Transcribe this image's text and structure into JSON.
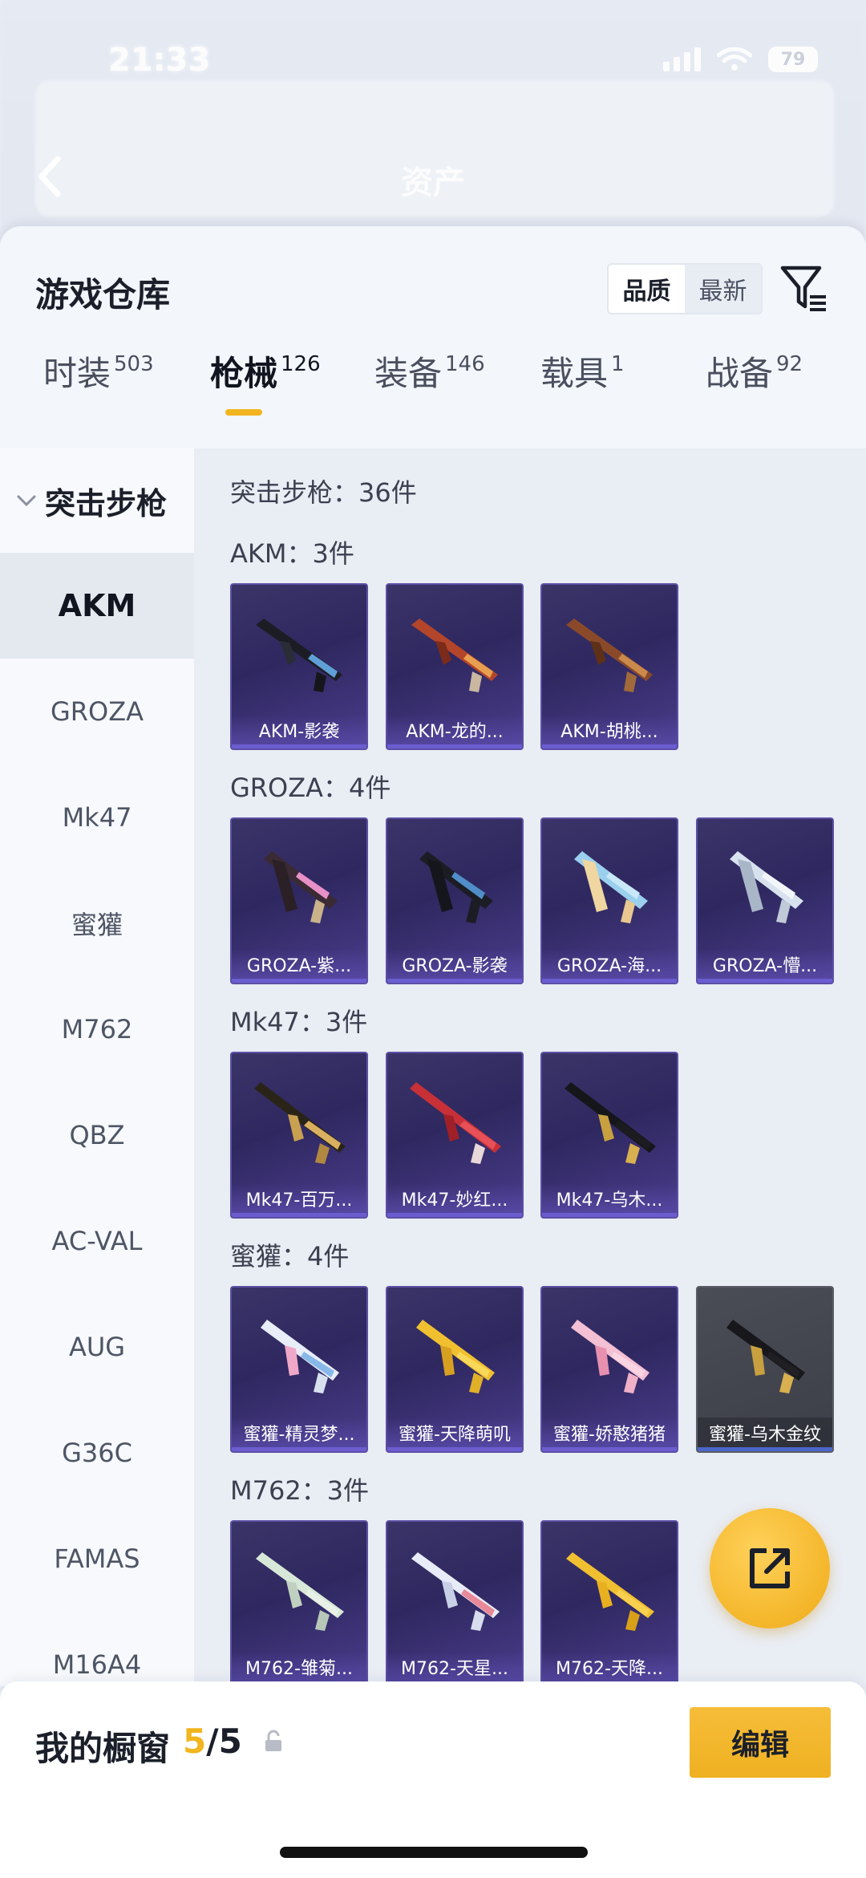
{
  "status_bar": {
    "time": "21:33",
    "battery": "79"
  },
  "header": {
    "title": "资产"
  },
  "sheet": {
    "title": "游戏仓库"
  },
  "sort": {
    "quality": "品质",
    "newest": "最新"
  },
  "tabs": [
    {
      "label": "时装",
      "count": "503"
    },
    {
      "label": "枪械",
      "count": "126"
    },
    {
      "label": "装备",
      "count": "146"
    },
    {
      "label": "载具",
      "count": "1"
    },
    {
      "label": "战备",
      "count": "92"
    }
  ],
  "sidebar": {
    "category": "突击步枪",
    "items": [
      "AKM",
      "GROZA",
      "Mk47",
      "蜜獾",
      "M762",
      "QBZ",
      "AC-VAL",
      "AUG",
      "G36C",
      "FAMAS",
      "M16A4"
    ]
  },
  "content": {
    "total": "突击步枪：36件",
    "groups": [
      {
        "title": "AKM：3件",
        "items": [
          "AKM-影袭",
          "AKM-龙的...",
          "AKM-胡桃..."
        ]
      },
      {
        "title": "GROZA：4件",
        "items": [
          "GROZA-紫...",
          "GROZA-影袭",
          "GROZA-海...",
          "GROZA-懵..."
        ]
      },
      {
        "title": "Mk47：3件",
        "items": [
          "Mk47-百万...",
          "Mk47-妙红...",
          "Mk47-乌木..."
        ]
      },
      {
        "title": "蜜獾：4件",
        "items": [
          "蜜獾-精灵梦...",
          "蜜獾-天降萌叽",
          "蜜獾-娇憨猪猪",
          "蜜獾-乌木金纹"
        ]
      },
      {
        "title": "M762：3件",
        "items": [
          "M762-雏菊...",
          "M762-天星...",
          "M762-天降..."
        ]
      }
    ]
  },
  "showcase": {
    "title": "我的橱窗",
    "current": "5",
    "total": "/5",
    "edit_label": "编辑"
  },
  "colors": {
    "accent": "#f2b51f",
    "card_bg": "#2f2860",
    "card_border": "#5c4fa5"
  },
  "icons": [
    "back-icon",
    "filter-icon",
    "chevron-down-icon",
    "share-icon",
    "lock-icon"
  ]
}
